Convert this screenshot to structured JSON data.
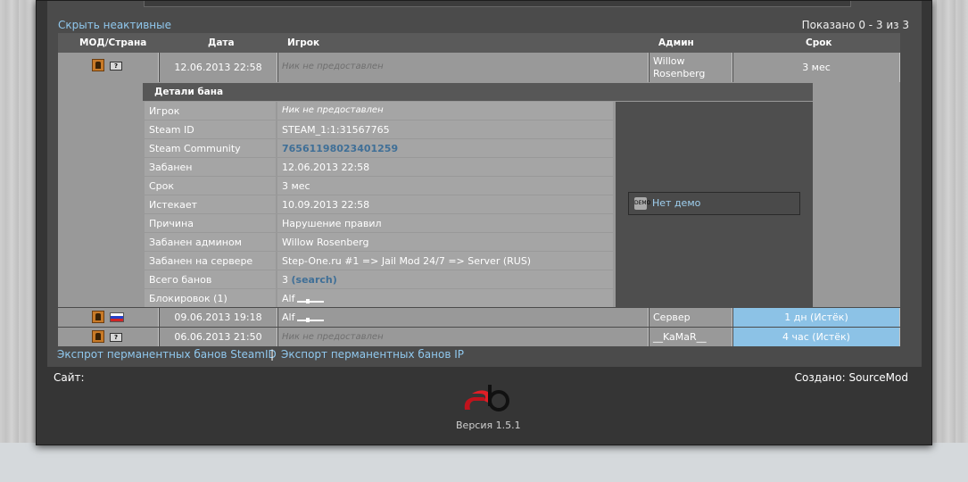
{
  "header": {
    "hide_inactive": "Скрыть неактивные",
    "shown_count": "Показано 0 - 3 из 3"
  },
  "columns": [
    "МОД/Страна",
    "Дата",
    "Игрок",
    "Админ",
    "Срок"
  ],
  "bans": [
    {
      "date": "12.06.2013 22:58",
      "player": "Ник не предоставлен",
      "admin": "Willow Rosenberg",
      "length": "3 мес",
      "flag": "unknown-flag-icon"
    },
    {
      "date": "09.06.2013 19:18",
      "player": "Alf",
      "admin": "Сервер",
      "length": "1 дн (Истёк)",
      "flag": "russia-flag-icon"
    },
    {
      "date": "06.06.2013 21:50",
      "player": "Ник не предоставлен",
      "admin": "__KaMaR__",
      "length": "4 час (Истёк)",
      "flag": "unknown-flag-icon"
    }
  ],
  "details": {
    "title": "Детали бана",
    "rows": [
      {
        "label": "Игрок",
        "value": "Ник не предоставлен"
      },
      {
        "label": "Steam ID",
        "value": "STEAM_1:1:31567765"
      },
      {
        "label": "Steam Community",
        "value": "76561198023401259"
      },
      {
        "label": "Забанен",
        "value": "12.06.2013 22:58"
      },
      {
        "label": "Срок",
        "value": "3 мес"
      },
      {
        "label": "Истекает",
        "value": "10.09.2013 22:58"
      },
      {
        "label": "Причина",
        "value": "Нарушение правил"
      },
      {
        "label": "Забанен админом",
        "value": "Willow Rosenberg"
      },
      {
        "label": "Забанен на сервере",
        "value": "Step-One.ru #1 => Jail Mod 24/7 => Server (RUS)"
      },
      {
        "label": "Всего банов",
        "value": "3",
        "extra": "(search)"
      },
      {
        "label": "Блокировок (1)",
        "value": "Alf"
      }
    ],
    "demo_label": "Нет демо",
    "demo_icon_text": "DEMO"
  },
  "footer": {
    "export_steamid": "Экспрот перманентных банов SteamID",
    "separator": "|",
    "export_ip": "Экспорт перманентных банов IP",
    "site_label": "Сайт:",
    "created_by": "Создано: SourceMod",
    "version": "Версия 1.5.1"
  },
  "colors": {
    "expired": "#8cc2e6",
    "link": "#90c8ee"
  }
}
